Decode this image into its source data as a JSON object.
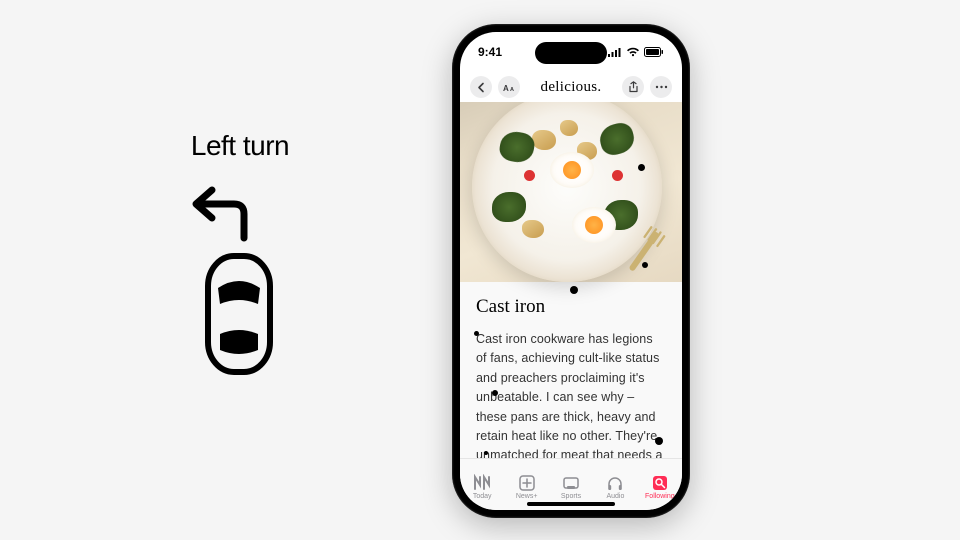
{
  "diagram": {
    "title": "Left turn"
  },
  "status": {
    "time": "9:41"
  },
  "nav": {
    "title": "delicious."
  },
  "article": {
    "section_title": "Cast iron",
    "body": "Cast iron cookware has legions of fans, achieving cult-like status and preachers proclaiming it's unbeatable. I can see why – these pans are thick, heavy and retain heat like no other. They're unmatched for meat that needs a strong sear; hav-"
  },
  "tabs": [
    {
      "label": "Today"
    },
    {
      "label": "News+"
    },
    {
      "label": "Sports"
    },
    {
      "label": "Audio"
    },
    {
      "label": "Following"
    }
  ]
}
